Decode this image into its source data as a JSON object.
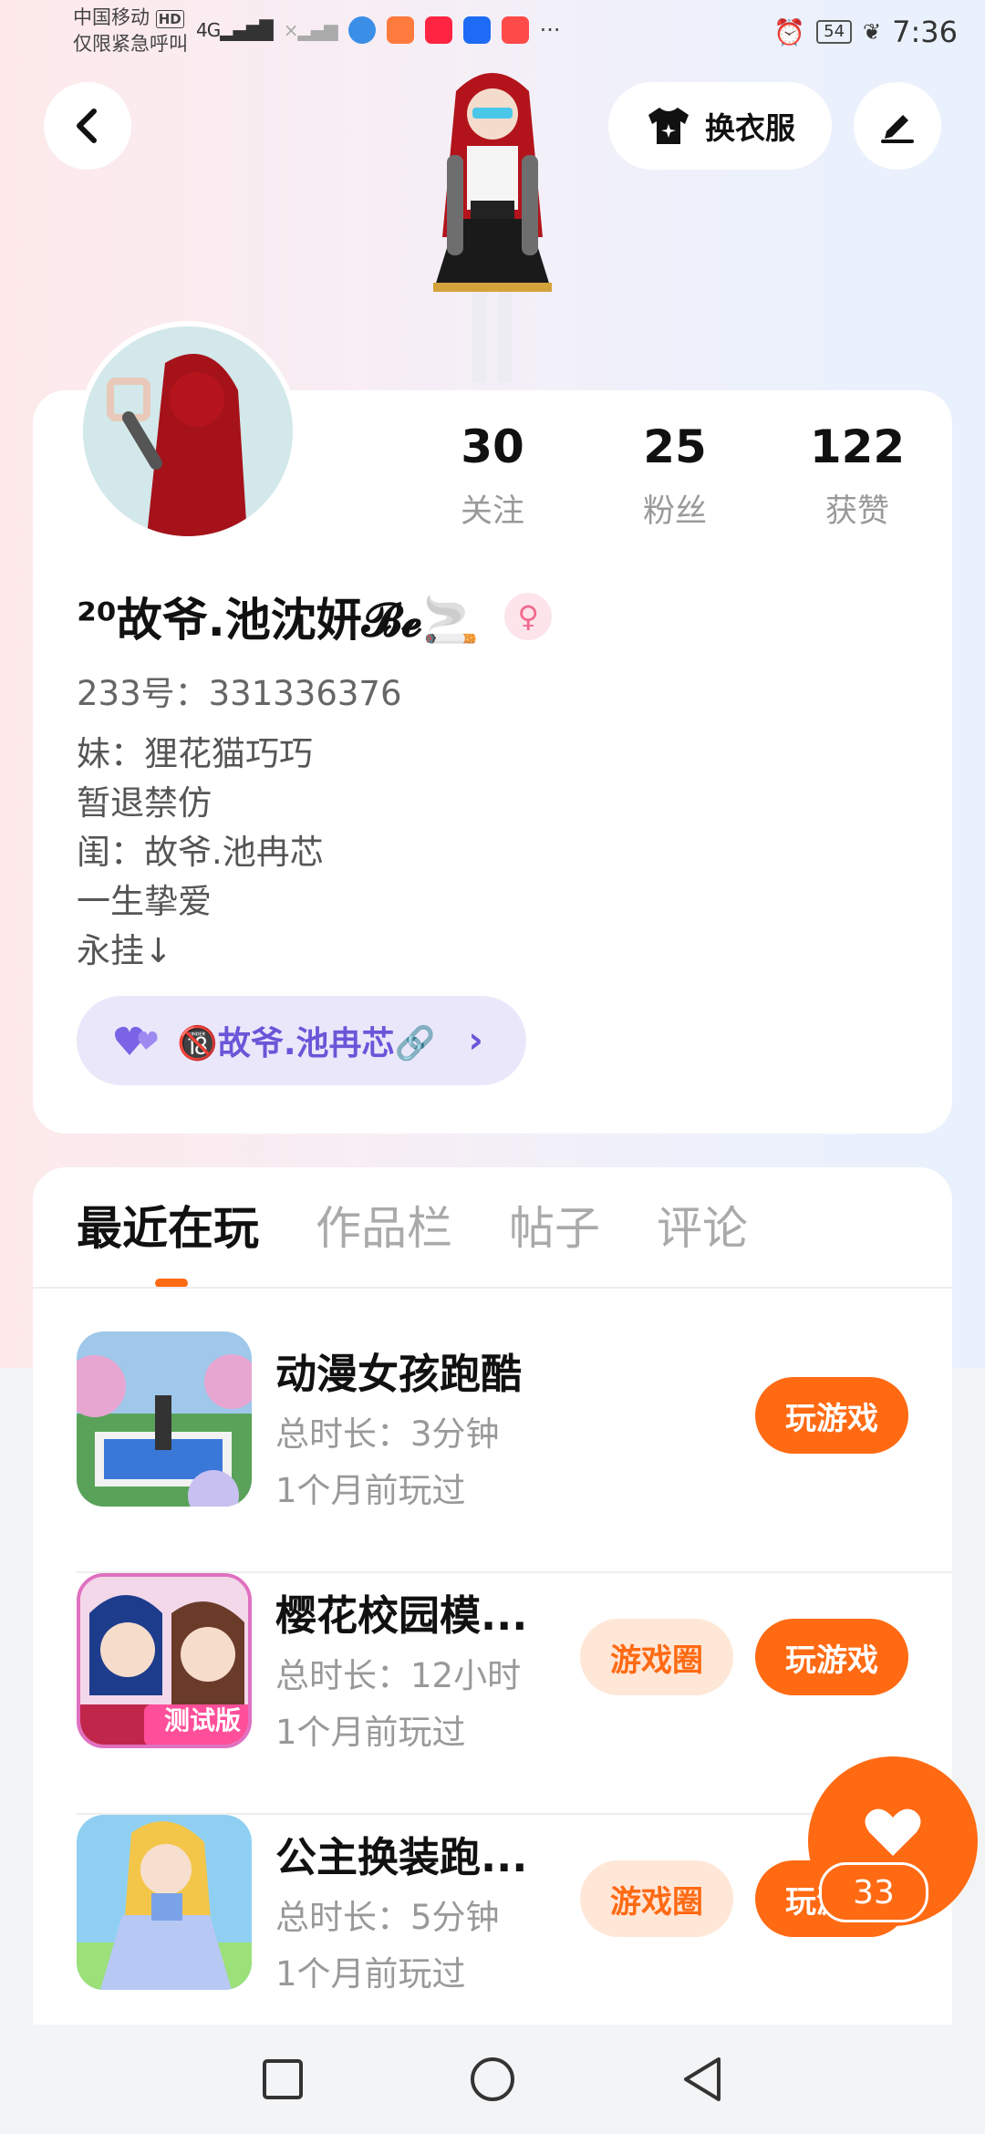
{
  "status_bar": {
    "carrier": "中国移动",
    "hd_badge": "HD",
    "emergency_text": "仅限紧急呼叫",
    "network": "4G",
    "more_dots": "···",
    "battery": "54",
    "time": "7:36"
  },
  "header": {
    "back_icon": "chevron-left-icon",
    "outfit_label": "换衣服",
    "edit_icon": "pencil-icon"
  },
  "profile": {
    "stats": [
      {
        "value": "30",
        "label": "关注"
      },
      {
        "value": "25",
        "label": "粉丝"
      },
      {
        "value": "122",
        "label": "获赞"
      }
    ],
    "username": "²⁰故爷.池沈妍𝓑𝓮🚬",
    "gender_icon": "female-icon",
    "uid": "233号：331336376",
    "bio": [
      "妹：狸花猫巧巧",
      "暂退禁仿",
      "闺：故爷.池冉芯",
      "一生挚爱",
      "永挂↓"
    ],
    "cp_link": {
      "icon": "double-heart-icon",
      "label": "🔞故爷.池冉芯🔗",
      "arrow": "›"
    }
  },
  "tabs": [
    "最近在玩",
    "作品栏",
    "帖子",
    "评论"
  ],
  "games": [
    {
      "title": "动漫女孩跑酷",
      "duration": "总时长：3分钟",
      "last_played": "1个月前玩过",
      "circle": null,
      "play": "玩游戏"
    },
    {
      "title": "樱花校园模...",
      "duration": "总时长：12小时",
      "last_played": "1个月前玩过",
      "circle": "游戏圈",
      "play": "玩游戏",
      "badge": "测试版"
    },
    {
      "title": "公主换装跑...",
      "duration": "总时长：5分钟",
      "last_played": "1个月前玩过",
      "circle": "游戏圈",
      "play": "玩游戏"
    }
  ],
  "like_fab": {
    "icon": "heart-icon",
    "count": "33"
  },
  "nav": {
    "recent": "square-icon",
    "home": "circle-icon",
    "back": "triangle-back-icon"
  },
  "colors": {
    "accent": "#ff6a13",
    "purple": "#6a56d8",
    "pink": "#f06a8e"
  }
}
